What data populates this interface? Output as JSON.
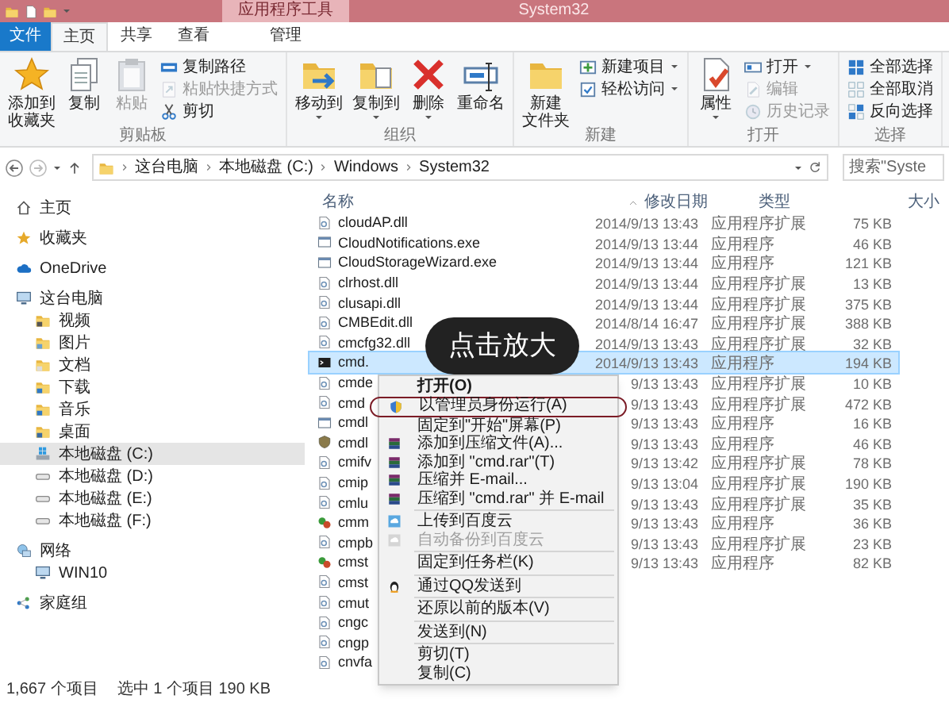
{
  "title_bar": {
    "tool_tab": "应用程序工具",
    "title": "System32"
  },
  "ribbon": {
    "tabs": [
      {
        "label": "文件",
        "kind": "file",
        "selected": false
      },
      {
        "label": "主页",
        "kind": "normal",
        "selected": true
      },
      {
        "label": "共享",
        "kind": "normal",
        "selected": false
      },
      {
        "label": "查看",
        "kind": "normal",
        "selected": false
      },
      {
        "label": "管理",
        "kind": "contextual",
        "selected": false
      }
    ],
    "groups": [
      {
        "label": "剪贴板",
        "buttons": [
          {
            "label": [
              "添加到",
              "收藏夹"
            ],
            "kind": "large",
            "disabled": false,
            "dropdown": false
          },
          {
            "label": "复制",
            "kind": "large",
            "disabled": false,
            "dropdown": false
          },
          {
            "label": "粘贴",
            "kind": "large",
            "disabled": true,
            "dropdown": false
          },
          {
            "label": "复制路径",
            "kind": "small",
            "disabled": false,
            "dropdown": false
          },
          {
            "label": "粘贴快捷方式",
            "kind": "small",
            "disabled": true,
            "dropdown": false
          },
          {
            "label": "剪切",
            "kind": "small",
            "disabled": false,
            "dropdown": false
          }
        ]
      },
      {
        "label": "组织",
        "buttons": [
          {
            "label": "移动到",
            "kind": "large",
            "disabled": false,
            "dropdown": true
          },
          {
            "label": "复制到",
            "kind": "large",
            "disabled": false,
            "dropdown": true
          },
          {
            "label": "删除",
            "kind": "large",
            "disabled": false,
            "dropdown": true
          },
          {
            "label": "重命名",
            "kind": "large",
            "disabled": false,
            "dropdown": false
          }
        ]
      },
      {
        "label": "新建",
        "buttons": [
          {
            "label": [
              "新建",
              "文件夹"
            ],
            "kind": "large",
            "disabled": false,
            "dropdown": false
          },
          {
            "label": "新建项目",
            "kind": "small",
            "disabled": false,
            "dropdown": true
          },
          {
            "label": "轻松访问",
            "kind": "small",
            "disabled": false,
            "dropdown": true
          }
        ]
      },
      {
        "label": "打开",
        "buttons": [
          {
            "label": "属性",
            "kind": "large",
            "disabled": false,
            "dropdown": true
          },
          {
            "label": "打开",
            "kind": "small",
            "disabled": false,
            "dropdown": true
          },
          {
            "label": "编辑",
            "kind": "small",
            "disabled": true,
            "dropdown": false
          },
          {
            "label": "历史记录",
            "kind": "small",
            "disabled": true,
            "dropdown": false
          }
        ]
      },
      {
        "label": "选择",
        "buttons": [
          {
            "label": "全部选择",
            "kind": "small",
            "disabled": false,
            "dropdown": false
          },
          {
            "label": "全部取消",
            "kind": "small",
            "disabled": false,
            "dropdown": false
          },
          {
            "label": "反向选择",
            "kind": "small",
            "disabled": false,
            "dropdown": false
          }
        ]
      }
    ]
  },
  "address_bar": {
    "path": [
      "这台电脑",
      "本地磁盘 (C:)",
      "Windows",
      "System32"
    ],
    "search": {
      "placeholder": "搜索\"Syste"
    }
  },
  "nav": [
    {
      "label": "主页",
      "selected": false
    },
    {
      "label": "收藏夹",
      "selected": false
    },
    {
      "label": "OneDrive",
      "selected": false
    },
    {
      "label": "这台电脑",
      "selected": false,
      "children": [
        {
          "label": "视频",
          "selected": false
        },
        {
          "label": "图片",
          "selected": false
        },
        {
          "label": "文档",
          "selected": false
        },
        {
          "label": "下载",
          "selected": false
        },
        {
          "label": "音乐",
          "selected": false
        },
        {
          "label": "桌面",
          "selected": false
        },
        {
          "label": "本地磁盘 (C:)",
          "selected": true
        },
        {
          "label": "本地磁盘 (D:)",
          "selected": false
        },
        {
          "label": "本地磁盘 (E:)",
          "selected": false
        },
        {
          "label": "本地磁盘 (F:)",
          "selected": false
        }
      ]
    },
    {
      "label": "网络",
      "selected": false,
      "children": [
        {
          "label": "WIN10",
          "selected": false
        }
      ]
    },
    {
      "label": "家庭组",
      "selected": false
    }
  ],
  "file_list": {
    "columns": [
      "名称",
      "修改日期",
      "类型",
      "大小"
    ],
    "rows": [
      {
        "name": "cloudAP.dll",
        "date": "2014/9/13 13:43",
        "type": "应用程序扩展",
        "size": "75 KB",
        "kind": "dll",
        "selected": false
      },
      {
        "name": "CloudNotifications.exe",
        "date": "2014/9/13 13:44",
        "type": "应用程序",
        "size": "46 KB",
        "kind": "exe",
        "selected": false
      },
      {
        "name": "CloudStorageWizard.exe",
        "date": "2014/9/13 13:44",
        "type": "应用程序",
        "size": "121 KB",
        "kind": "exe",
        "selected": false
      },
      {
        "name": "clrhost.dll",
        "date": "2014/9/13 13:44",
        "type": "应用程序扩展",
        "size": "13 KB",
        "kind": "dll",
        "selected": false
      },
      {
        "name": "clusapi.dll",
        "date": "2014/9/13 13:44",
        "type": "应用程序扩展",
        "size": "375 KB",
        "kind": "dll",
        "selected": false
      },
      {
        "name": "CMBEdit.dll",
        "date": "2014/8/14 16:47",
        "type": "应用程序扩展",
        "size": "388 KB",
        "kind": "dll",
        "selected": false
      },
      {
        "name": "cmcfg32.dll",
        "date": "2014/9/13 13:43",
        "type": "应用程序扩展",
        "size": "32 KB",
        "kind": "dll",
        "selected": false
      },
      {
        "name": "cmd.",
        "date": "2014/9/13 13:43",
        "type": "应用程序",
        "size": "194 KB",
        "kind": "console",
        "selected": true
      },
      {
        "name": "cmde",
        "date": "9/13 13:43",
        "type": "应用程序扩展",
        "size": "10 KB",
        "kind": "dll",
        "selected": false
      },
      {
        "name": "cmd",
        "date": "9/13 13:43",
        "type": "应用程序扩展",
        "size": "472 KB",
        "kind": "dll",
        "selected": false
      },
      {
        "name": "cmdl",
        "date": "9/13 13:43",
        "type": "应用程序",
        "size": "16 KB",
        "kind": "exe",
        "selected": false
      },
      {
        "name": "cmdl",
        "date": "9/13 13:43",
        "type": "应用程序",
        "size": "46 KB",
        "kind": "shield",
        "selected": false
      },
      {
        "name": "cmifv",
        "date": "9/13 13:42",
        "type": "应用程序扩展",
        "size": "78 KB",
        "kind": "dll",
        "selected": false
      },
      {
        "name": "cmip",
        "date": "9/13 13:04",
        "type": "应用程序扩展",
        "size": "190 KB",
        "kind": "dll",
        "selected": false
      },
      {
        "name": "cmlu",
        "date": "9/13 13:43",
        "type": "应用程序扩展",
        "size": "35 KB",
        "kind": "dll",
        "selected": false
      },
      {
        "name": "cmm",
        "date": "9/13 13:43",
        "type": "应用程序",
        "size": "36 KB",
        "kind": "colorful",
        "selected": false
      },
      {
        "name": "cmpb",
        "date": "9/13 13:43",
        "type": "应用程序扩展",
        "size": "23 KB",
        "kind": "dll",
        "selected": false
      },
      {
        "name": "cmst",
        "date": "9/13 13:43",
        "type": "应用程序",
        "size": "82 KB",
        "kind": "colorful",
        "selected": false
      },
      {
        "name": "cmst",
        "kind": "dll",
        "selected": false
      },
      {
        "name": "cmut",
        "kind": "dll",
        "selected": false
      },
      {
        "name": "cngc",
        "kind": "dll",
        "selected": false
      },
      {
        "name": "cngp",
        "kind": "dll",
        "selected": false
      },
      {
        "name": "cnvfa",
        "kind": "dll",
        "selected": false
      }
    ]
  },
  "context_menu": {
    "items": [
      {
        "kind": "item",
        "label": "打开(O)",
        "bold": true,
        "disabled": false,
        "circled": false
      },
      {
        "kind": "item",
        "label": "以管理员身份运行(A)",
        "bold": false,
        "disabled": false,
        "circled": true
      },
      {
        "kind": "item",
        "label": "固定到\"开始\"屏幕(P)",
        "bold": false,
        "disabled": false,
        "circled": false
      },
      {
        "kind": "item",
        "label": "添加到压缩文件(A)...",
        "bold": false,
        "disabled": false,
        "circled": false
      },
      {
        "kind": "item",
        "label": "添加到 \"cmd.rar\"(T)",
        "bold": false,
        "disabled": false,
        "circled": false
      },
      {
        "kind": "item",
        "label": "压缩并 E-mail...",
        "bold": false,
        "disabled": false,
        "circled": false
      },
      {
        "kind": "item",
        "label": "压缩到 \"cmd.rar\" 并 E-mail",
        "bold": false,
        "disabled": false,
        "circled": false
      },
      {
        "kind": "separator"
      },
      {
        "kind": "item",
        "label": "上传到百度云",
        "bold": false,
        "disabled": false,
        "circled": false
      },
      {
        "kind": "item",
        "label": "自动备份到百度云",
        "bold": false,
        "disabled": true,
        "circled": false
      },
      {
        "kind": "separator"
      },
      {
        "kind": "item",
        "label": "固定到任务栏(K)",
        "bold": false,
        "disabled": false,
        "circled": false
      },
      {
        "kind": "separator"
      },
      {
        "kind": "item",
        "label": "通过QQ发送到",
        "bold": false,
        "disabled": false,
        "circled": false
      },
      {
        "kind": "separator"
      },
      {
        "kind": "item",
        "label": "还原以前的版本(V)",
        "bold": false,
        "disabled": false,
        "circled": false
      },
      {
        "kind": "separator"
      },
      {
        "kind": "item",
        "label": "发送到(N)",
        "bold": false,
        "disabled": false,
        "circled": false
      },
      {
        "kind": "separator"
      },
      {
        "kind": "item",
        "label": "剪切(T)",
        "bold": false,
        "disabled": false,
        "circled": false
      },
      {
        "kind": "item",
        "label": "复制(C)",
        "bold": false,
        "disabled": false,
        "circled": false
      }
    ]
  },
  "zoom_hint": "点击放大",
  "status_bar": {
    "item_count": "1,667 个项目",
    "selection": "选中 1 个项目 190 KB"
  }
}
